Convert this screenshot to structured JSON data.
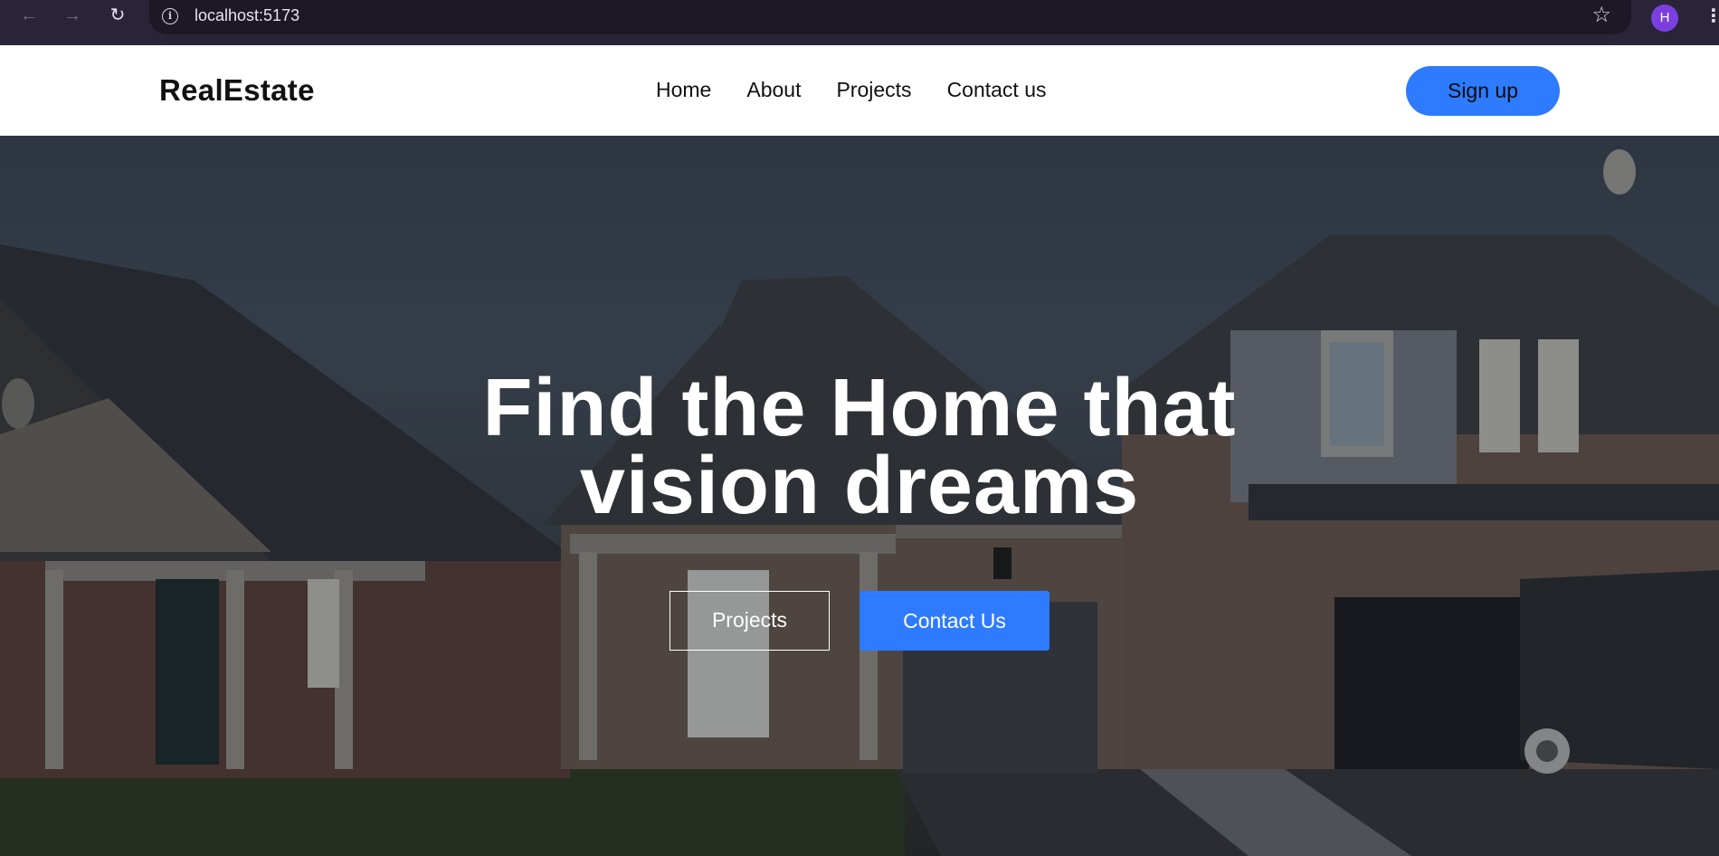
{
  "browser": {
    "url": "localhost:5173",
    "profile_initial": "H",
    "icons": [
      "back-arrow-icon",
      "forward-arrow-icon",
      "reload-icon",
      "info-icon",
      "star-icon",
      "kebab-menu-icon"
    ]
  },
  "header": {
    "brand": "RealEstate",
    "nav": [
      {
        "label": "Home"
      },
      {
        "label": "About"
      },
      {
        "label": "Projects"
      },
      {
        "label": "Contact us"
      }
    ],
    "signup_label": "Sign up"
  },
  "hero": {
    "title_line1": "Find the Home that",
    "title_line2": "vision dreams",
    "primary_button": "Projects",
    "secondary_button": "Contact Us"
  },
  "colors": {
    "accent": "#2e7bff",
    "chrome": "#2a2438",
    "avatar": "#7b3fe0"
  }
}
